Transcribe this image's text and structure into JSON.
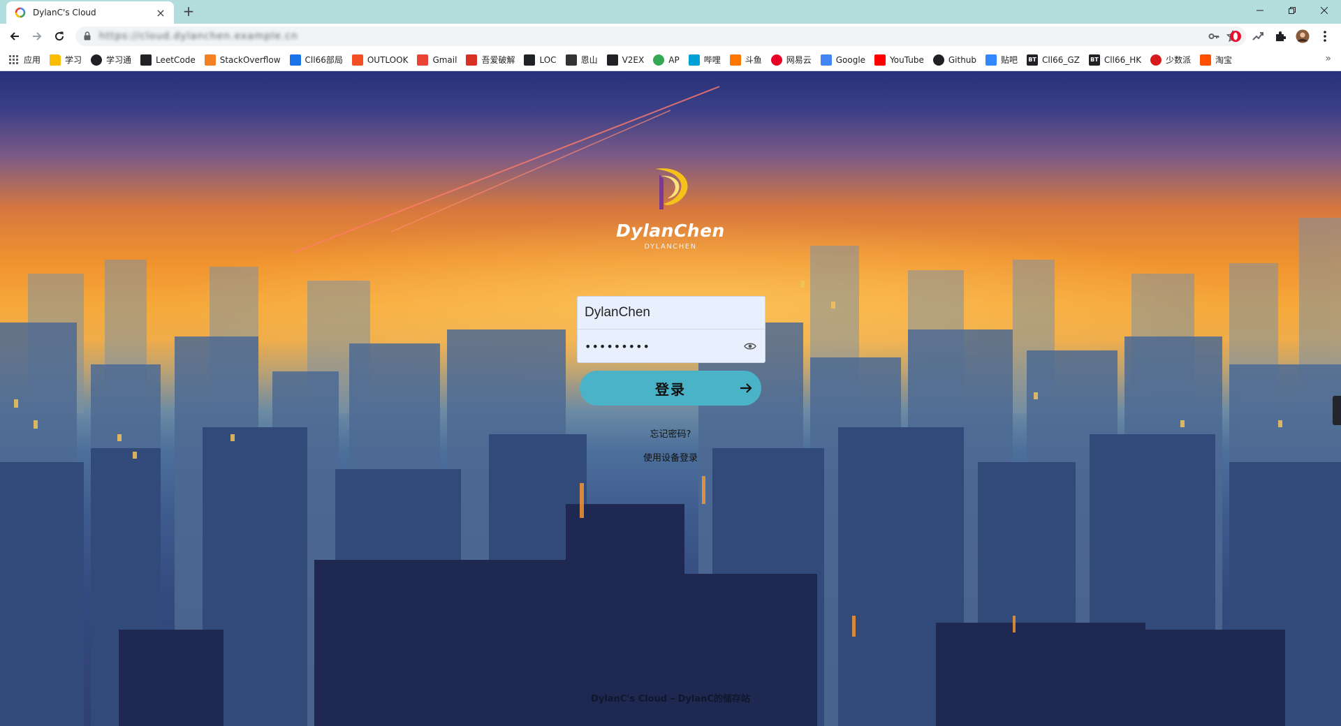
{
  "tab": {
    "title": "DylanC's Cloud"
  },
  "omnibox": {
    "url": "https://cloud.dylanchen.example.cn"
  },
  "bookmarks": [
    {
      "label": "应用",
      "icon": "apps-grid-icon",
      "color": "#5f6368"
    },
    {
      "label": "学习",
      "icon": "folder-icon",
      "color": "#fbbc04"
    },
    {
      "label": "学习通",
      "icon": "globe-icon",
      "color": "#202124"
    },
    {
      "label": "LeetCode",
      "icon": "leetcode-icon",
      "color": "#202124"
    },
    {
      "label": "StackOverflow",
      "icon": "stackoverflow-icon",
      "color": "#f48024"
    },
    {
      "label": "Cll66部局",
      "icon": "bracket-icon",
      "color": "#1a73e8"
    },
    {
      "label": "OUTLOOK",
      "icon": "windows-icon",
      "color": "#f25022"
    },
    {
      "label": "Gmail",
      "icon": "gmail-icon",
      "color": "#ea4335"
    },
    {
      "label": "吾爱破解",
      "icon": "wuai-icon",
      "color": "#d93025"
    },
    {
      "label": "LOC",
      "icon": "shield-icon",
      "color": "#202124"
    },
    {
      "label": "恩山",
      "icon": "enshan-icon",
      "color": "#333333"
    },
    {
      "label": "V2EX",
      "icon": "v2ex-icon",
      "color": "#202124"
    },
    {
      "label": "AP",
      "icon": "ap-icon",
      "color": "#34a853"
    },
    {
      "label": "哔哩",
      "icon": "bilibili-icon",
      "color": "#00a1d6"
    },
    {
      "label": "斗鱼",
      "icon": "douyu-icon",
      "color": "#ff7700"
    },
    {
      "label": "网易云",
      "icon": "netease-music-icon",
      "color": "#e60026"
    },
    {
      "label": "Google",
      "icon": "google-icon",
      "color": "#4285f4"
    },
    {
      "label": "YouTube",
      "icon": "youtube-icon",
      "color": "#ff0000"
    },
    {
      "label": "Github",
      "icon": "github-icon",
      "color": "#202124"
    },
    {
      "label": "贴吧",
      "icon": "tieba-icon",
      "color": "#3388ff"
    },
    {
      "label": "Cll66_GZ",
      "icon": "bt-icon",
      "color": "#202124"
    },
    {
      "label": "Cll66_HK",
      "icon": "bt-icon",
      "color": "#202124"
    },
    {
      "label": "少数派",
      "icon": "sspai-icon",
      "color": "#d71a1b"
    },
    {
      "label": "淘宝",
      "icon": "taobao-icon",
      "color": "#ff5000"
    }
  ],
  "logo": {
    "brand": "DylanChen",
    "sub": "DYLANCHEN"
  },
  "login": {
    "username": "DylanChen",
    "password_mask": "•••••••••",
    "button": "登录",
    "forgot": "忘记密码?",
    "device_login": "使用设备登录"
  },
  "footer": "DylanC's Cloud – DylanC的储存站",
  "colors": {
    "login_button": "#4ab3c8",
    "tabstrip": "#b3dcdd",
    "input_bg": "#e8f0fe"
  }
}
